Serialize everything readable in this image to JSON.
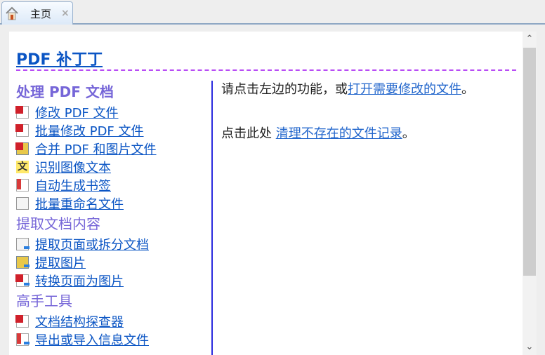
{
  "tab": {
    "label": "主页",
    "icon": "home-icon",
    "close": "×"
  },
  "title": "PDF 补丁丁",
  "sections": [
    {
      "heading": "处理 PDF 文档",
      "items": [
        {
          "label": "修改 PDF 文件",
          "icon": "pdf-edit-icon"
        },
        {
          "label": "批量修改 PDF 文件",
          "icon": "pdf-batch-edit-icon"
        },
        {
          "label": "合并 PDF 和图片文件",
          "icon": "pdf-merge-icon"
        },
        {
          "label": "识别图像文本",
          "icon": "ocr-icon"
        },
        {
          "label": "自动生成书签",
          "icon": "bookmark-icon"
        },
        {
          "label": "批量重命名文件",
          "icon": "rename-icon"
        }
      ]
    },
    {
      "heading": "提取文档内容",
      "items": [
        {
          "label": "提取页面或拆分文档",
          "icon": "extract-pages-icon"
        },
        {
          "label": "提取图片",
          "icon": "extract-images-icon"
        },
        {
          "label": "转换页面为图片",
          "icon": "render-pages-icon"
        }
      ]
    },
    {
      "heading": "高手工具",
      "items": [
        {
          "label": "文档结构探查器",
          "icon": "inspector-icon"
        },
        {
          "label": "导出或导入信息文件",
          "icon": "export-import-icon"
        }
      ]
    }
  ],
  "right": {
    "line1_text": "请点击左边的功能，或",
    "line1_link": "打开需要修改的文件",
    "line1_end": "。",
    "line2_text": "点击此处 ",
    "line2_link": "清理不存在的文件记录",
    "line2_end": "。"
  },
  "scrollbar": {
    "up": "⌃",
    "down": "⌄"
  }
}
